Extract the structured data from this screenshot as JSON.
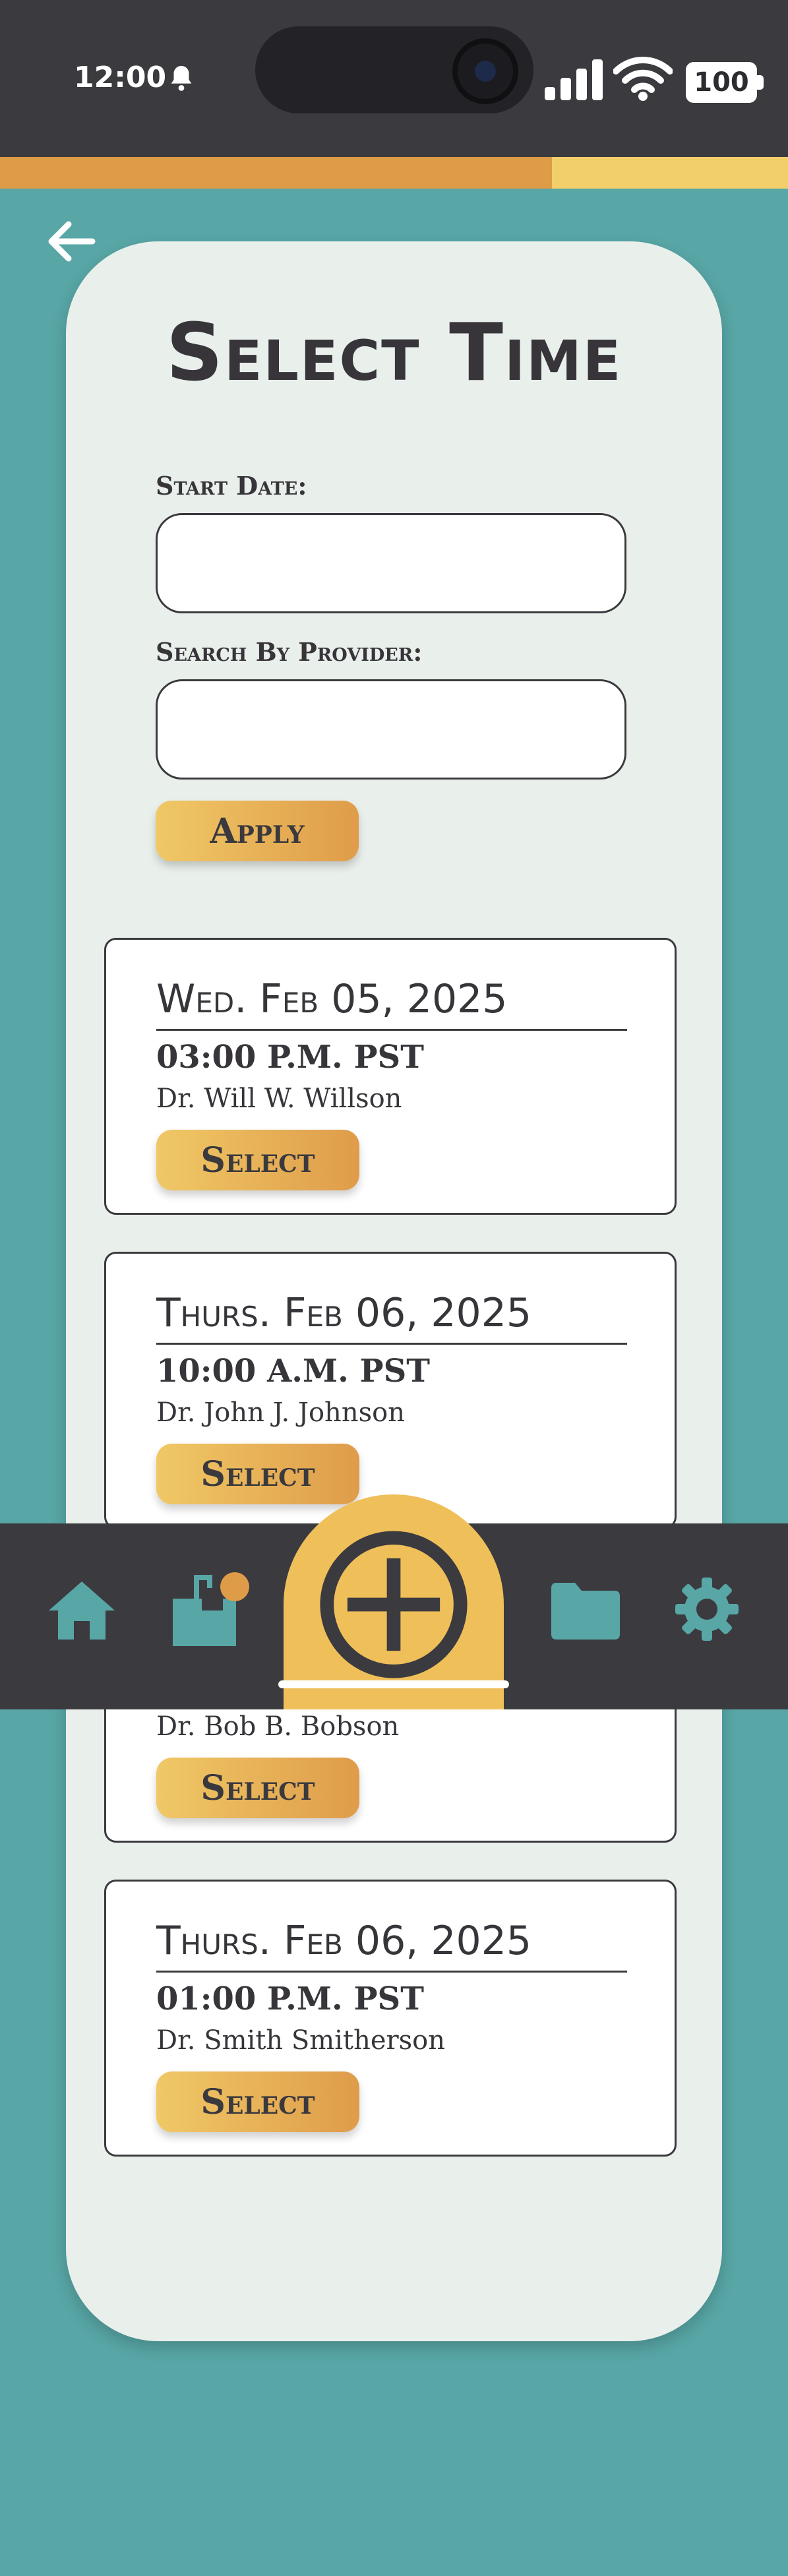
{
  "status_bar": {
    "time": "12:00",
    "battery": "100",
    "icons": [
      "bell-icon",
      "signal-icon",
      "wifi-icon",
      "battery-icon"
    ]
  },
  "progress": {
    "fraction": 0.7
  },
  "header": {
    "title": "Select Time",
    "back_icon": "arrow-left-icon"
  },
  "filters": {
    "start_date_label": "Start Date:",
    "start_date_value": "",
    "provider_label": "Search By Provider:",
    "provider_value": "",
    "apply_label": "Apply"
  },
  "slots": [
    {
      "date": "Wed. Feb 05, 2025",
      "time": "03:00 P.M. PST",
      "provider": "Dr. Will W. Willson",
      "button": "Select"
    },
    {
      "date": "Thurs. Feb 06, 2025",
      "time": "10:00 A.M. PST",
      "provider": "Dr. John J. Johnson",
      "button": "Select"
    },
    {
      "date": "",
      "time": "",
      "provider": "Dr. Bob B. Bobson",
      "button": "Select"
    },
    {
      "date": "Thurs. Feb 06, 2025",
      "time": "01:00 P.M. PST",
      "provider": "Dr. Smith Smitherson",
      "button": "Select"
    }
  ],
  "bottom_nav": {
    "items": [
      "home-icon",
      "inbox-icon",
      "add-icon",
      "folder-icon",
      "settings-icon"
    ],
    "active": "add-icon"
  },
  "colors": {
    "background": "#58a6a6",
    "panel": "#e9efeb",
    "dark": "#3b3a3f",
    "gold": "#efbf5a",
    "orange": "#de9b48",
    "teal_icon": "#58a6a6",
    "notification_dot": "#de9b48"
  }
}
